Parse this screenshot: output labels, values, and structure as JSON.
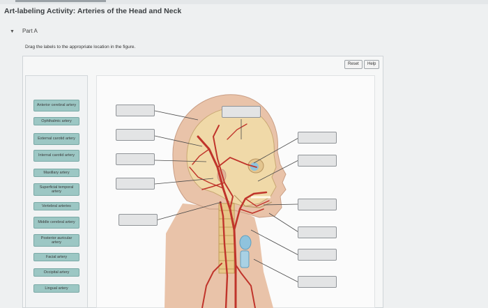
{
  "header": {
    "activity_title": "Art-labeling Activity: Arteries of the Head and Neck",
    "part_label": "Part A",
    "collapse_caret": "▼"
  },
  "instructions": "Drag the labels to the appropriate location in the figure.",
  "toolbar": {
    "reset_label": "Reset",
    "help_label": "Help"
  },
  "labels": [
    "Anterior cerebral artery",
    "Ophthalmic artery",
    "External carotid artery",
    "Internal carotid artery",
    "Maxillary artery",
    "Superficial temporal artery",
    "Vertebral arteries",
    "Middle cerebral artery",
    "Posterior auricular artery",
    "Facial artery",
    "Occipital artery",
    "Lingual artery"
  ],
  "colors": {
    "label_chip": "#9cc7c4",
    "artery": "#c0342b",
    "skull": "#f0d9a8",
    "spine": "#e8c788",
    "skin": "#e9c3a9",
    "ligament_blue": "#8fc3dd"
  }
}
